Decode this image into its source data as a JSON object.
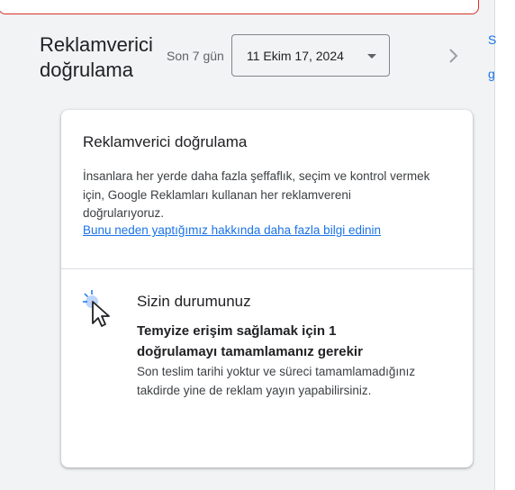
{
  "header": {
    "title": "Reklamverici doğrulama",
    "range_label": "Son 7 gün",
    "date_range": "11 Ekim 17, 2024",
    "next_icon": "chevron-right-icon",
    "dropdown_icon": "arrow-drop-down-icon"
  },
  "right_rail": {
    "link_1": "S",
    "link_2": "g"
  },
  "card": {
    "title": "Reklamverici doğrulama",
    "description": "İnsanlara her yerde daha fazla şeffaflık, seçim ve kontrol vermek için, Google Reklamları kullanan her reklamvereni doğrularıyoruz.",
    "learn_more_link": "Bunu neden yaptığımız hakkında daha fazla bilgi edinin",
    "status": {
      "icon": "cursor-click-icon",
      "heading": "Sizin durumunuz",
      "message": "Temyize erişim sağlamak için 1 doğrulamayı tamamlamanız gerekir",
      "note": "Son teslim tarihi yoktur ve süreci tamamlamadığınız takdirde yine de reklam yayın yapabilirsiniz."
    }
  },
  "colors": {
    "background": "#f1f3f4",
    "link": "#1a73e8",
    "alert_border": "#d93025",
    "icon_accent": "#aecbfa"
  }
}
